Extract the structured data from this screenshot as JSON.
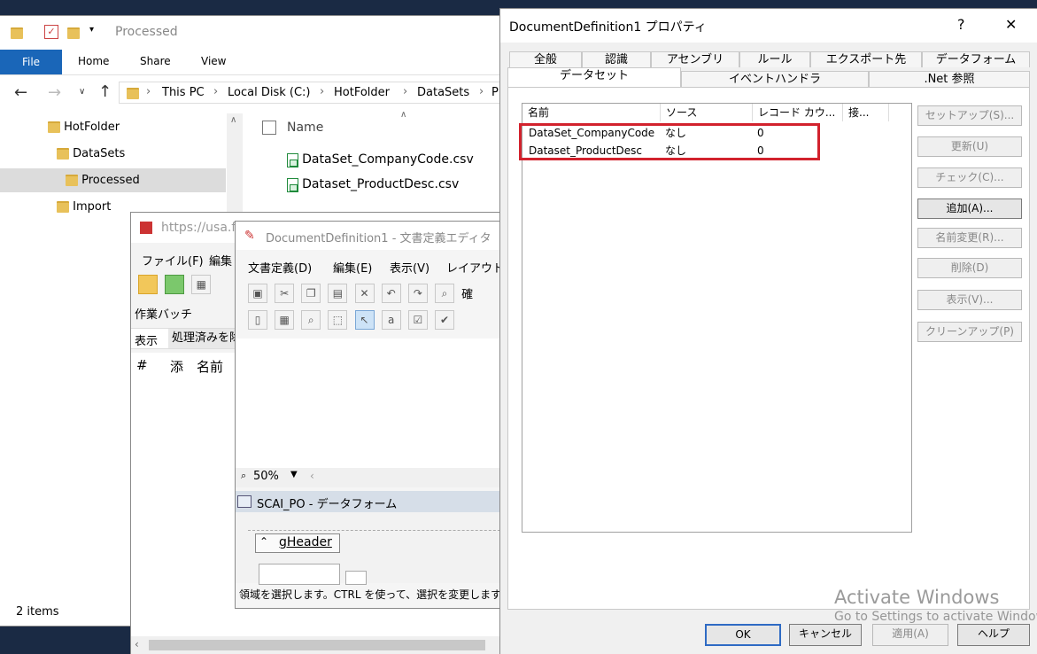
{
  "explorer": {
    "path_title": "Processed",
    "tabs": {
      "file": "File",
      "home": "Home",
      "share": "Share",
      "view": "View"
    },
    "breadcrumbs": [
      "This PC",
      "Local Disk (C:)",
      "HotFolder",
      "DataSets",
      "P"
    ],
    "tree": [
      "HotFolder",
      "DataSets",
      "Processed",
      "Import"
    ],
    "column_name": "Name",
    "files": [
      "DataSet_CompanyCode.csv",
      "Dataset_ProductDesc.csv"
    ],
    "status": "2 items"
  },
  "browser": {
    "url": "https://usa.fl",
    "menu": [
      "ファイル(F)",
      "編集"
    ],
    "section": "作業バッチ",
    "row1": [
      "表示",
      "処理済みを除"
    ],
    "columns": [
      "#",
      "添",
      "名前"
    ]
  },
  "editor": {
    "title": "DocumentDefinition1 - 文書定義エディタ",
    "menu": [
      "文書定義(D)",
      "編集(E)",
      "表示(V)",
      "レイアウト("
    ],
    "toolbar_text": "確",
    "zoom": "50%",
    "dataform_title": "SCAI_PO - データフォーム",
    "gheader": "gHeader",
    "status": "領域を選択します。CTRL を使って、選択を変更します"
  },
  "dialog": {
    "title": "DocumentDefinition1 プロパティ",
    "help": "?",
    "close": "✕",
    "tabs_row1": [
      "全般",
      "認識",
      "アセンブリ",
      "ルール",
      "エクスポート先",
      "データフォーム"
    ],
    "tabs_row2": [
      "データセット",
      "イベントハンドラ",
      ".Net 参照"
    ],
    "columns": [
      "名前",
      "ソース",
      "レコード カウ...",
      "接..."
    ],
    "rows": [
      {
        "name": "DataSet_CompanyCode",
        "source": "なし",
        "count": "0"
      },
      {
        "name": "Dataset_ProductDesc",
        "source": "なし",
        "count": "0"
      }
    ],
    "side_buttons": [
      "セットアップ(S)...",
      "更新(U)",
      "チェック(C)...",
      "追加(A)...",
      "名前変更(R)...",
      "削除(D)",
      "表示(V)...",
      "クリーンアップ(P)"
    ],
    "bottom_buttons": [
      "OK",
      "キャンセル",
      "適用(A)",
      "ヘルプ"
    ]
  },
  "watermark": {
    "line1": "Activate Windows",
    "line2": "Go to Settings to activate Windows."
  }
}
